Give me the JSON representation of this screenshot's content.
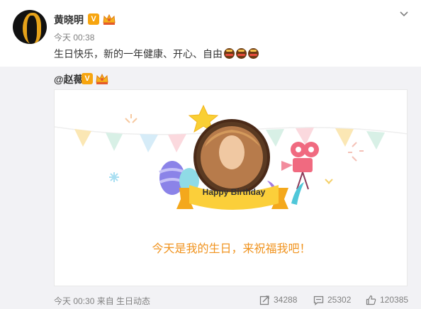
{
  "post": {
    "author": "黄晓明",
    "time": "今天 00:38",
    "text": "生日快乐，新的一年健康、开心、自由",
    "verified_badge": "V",
    "emojis": [
      "cake-emoji",
      "cake-emoji",
      "cake-emoji"
    ]
  },
  "repost": {
    "mention": "@赵薇",
    "verified_badge": "V",
    "card": {
      "ribbon_text": "Happy Birthday",
      "message": "今天是我的生日，来祝福我吧！"
    },
    "footer": {
      "meta": "今天 00:30 来自 生日动态",
      "reposts": "34288",
      "comments": "25302",
      "likes": "120385"
    }
  },
  "colors": {
    "accent_orange": "#f0931e",
    "badge_orange": "#f7a50f",
    "repost_bg": "#f2f2f5"
  }
}
